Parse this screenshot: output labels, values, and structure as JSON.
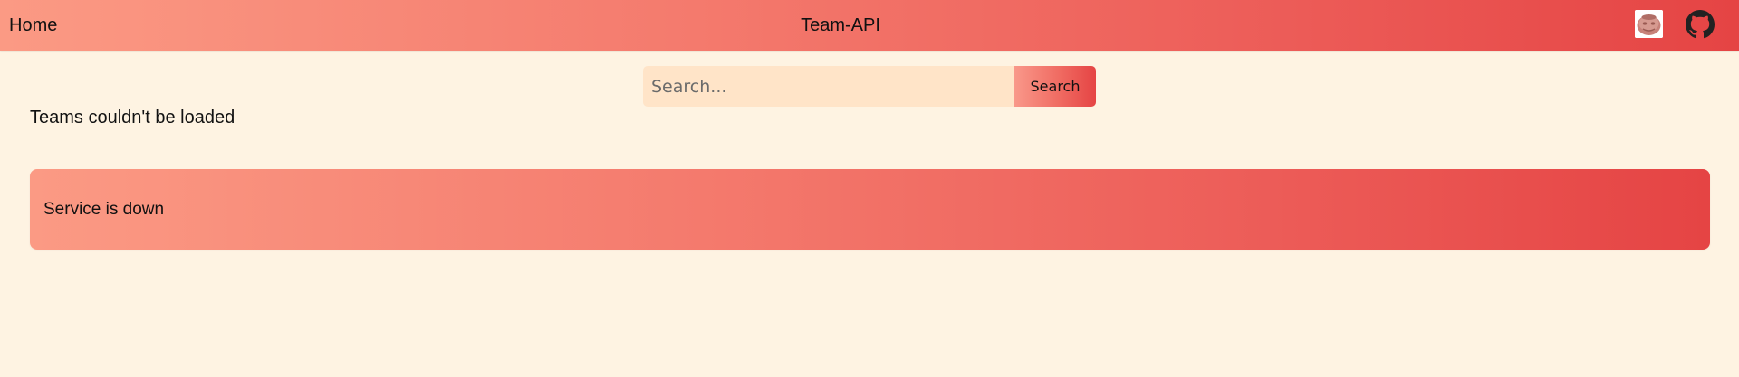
{
  "navbar": {
    "home_label": "Home",
    "title": "Team-API",
    "avatar_icon": "user-avatar-icon",
    "github_icon": "github-icon"
  },
  "search": {
    "placeholder": "Search...",
    "value": "",
    "button_label": "Search"
  },
  "status": {
    "teams_message": "Teams couldn't be loaded"
  },
  "alert": {
    "message": "Service is down"
  },
  "colors": {
    "page_background": "#fef3e2",
    "gradient_start": "#fb9a84",
    "gradient_end": "#e54444",
    "search_background": "#ffe4c8"
  }
}
